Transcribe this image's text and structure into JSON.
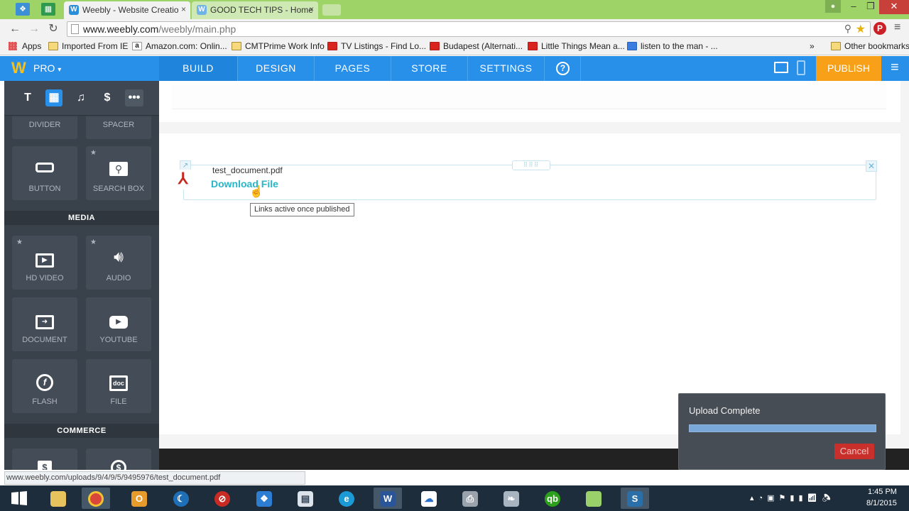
{
  "browser": {
    "tabs": [
      {
        "label": "Weebly - Website Creatio",
        "close": "×"
      },
      {
        "label": "GOOD TECH TIPS - Home",
        "close": "×"
      }
    ],
    "url_host": "www.weebly.com",
    "url_path": "/weebly/main.php",
    "bookmarks": [
      "Apps",
      "Imported From IE",
      "Amazon.com: Onlin...",
      "CMTPrime Work Info",
      "TV Listings - Find Lo...",
      "Budapest (Alternati...",
      "Little Things Mean a...",
      "listen to the man - ..."
    ],
    "bookmarks_overflow": "»",
    "other_bookmarks": "Other bookmarks"
  },
  "weebly": {
    "logo": "W",
    "plan": "PRO",
    "nav": [
      "BUILD",
      "DESIGN",
      "PAGES",
      "STORE",
      "SETTINGS"
    ],
    "help": "?",
    "publish": "PUBLISH"
  },
  "sidebar": {
    "top_tiles": [
      "DIVIDER",
      "SPACER"
    ],
    "tiles_basic": [
      "BUTTON",
      "SEARCH BOX"
    ],
    "media_header": "MEDIA",
    "media_tiles": [
      "HD VIDEO",
      "AUDIO",
      "DOCUMENT",
      "YOUTUBE",
      "FLASH",
      "FILE"
    ],
    "commerce_header": "COMMERCE"
  },
  "editor": {
    "filename": "test_document.pdf",
    "download_label": "Download File",
    "tooltip": "Links active once published"
  },
  "toast": {
    "title": "Upload Complete",
    "progress": 1.0,
    "cancel": "Cancel"
  },
  "status_url": "www.weebly.com/uploads/9/4/9/5/9495976/test_document.pdf",
  "taskbar": {
    "time": "1:45 PM",
    "date": "8/1/2015"
  },
  "colors": {
    "weebly_blue": "#2990ea",
    "publish_orange": "#f8a017",
    "download_teal": "#27b6c8",
    "sidebar_dark": "#39414a",
    "cancel_red": "#c9302c"
  }
}
